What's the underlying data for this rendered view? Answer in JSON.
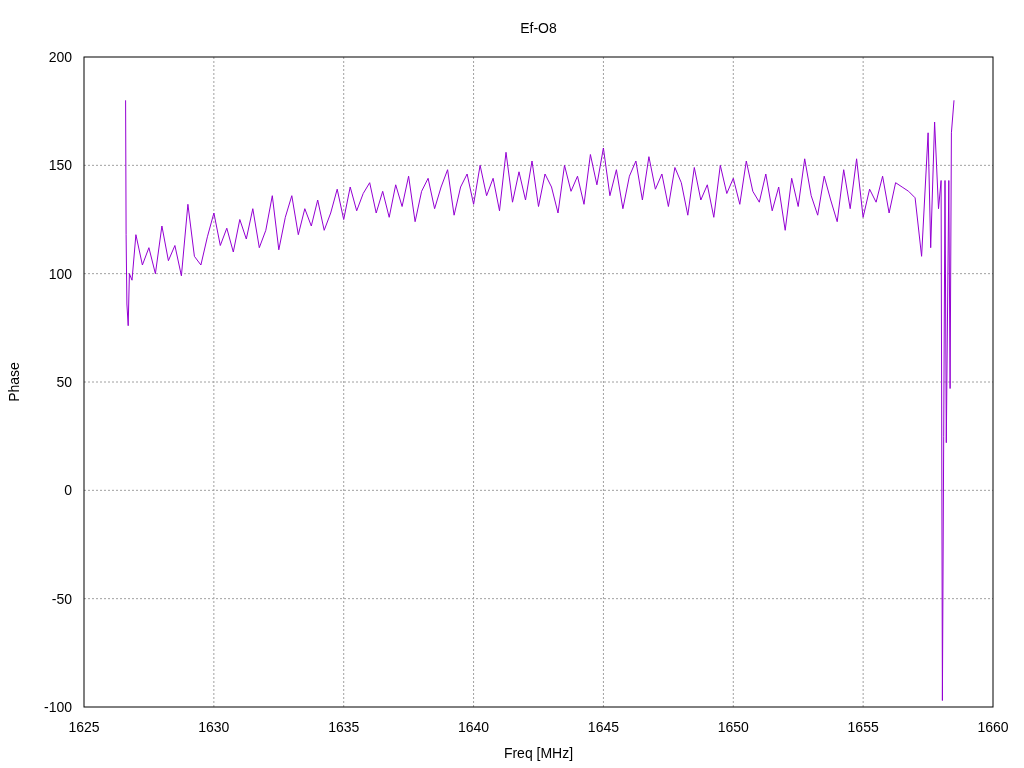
{
  "chart_data": {
    "type": "line",
    "title": "Ef-O8",
    "xlabel": "Freq [MHz]",
    "ylabel": "Phase",
    "x": [
      1626.6,
      1626.62,
      1626.65,
      1626.7,
      1626.75,
      1626.85,
      1627,
      1627.25,
      1627.5,
      1627.75,
      1628,
      1628.25,
      1628.5,
      1628.75,
      1629,
      1629.25,
      1629.5,
      1629.75,
      1630,
      1630.25,
      1630.5,
      1630.75,
      1631,
      1631.25,
      1631.5,
      1631.75,
      1632,
      1632.25,
      1632.5,
      1632.75,
      1633,
      1633.25,
      1633.5,
      1633.75,
      1634,
      1634.25,
      1634.5,
      1634.75,
      1635,
      1635.25,
      1635.5,
      1635.75,
      1636,
      1636.25,
      1636.5,
      1636.75,
      1637,
      1637.25,
      1637.5,
      1637.75,
      1638,
      1638.25,
      1638.5,
      1638.75,
      1639,
      1639.25,
      1639.5,
      1639.75,
      1640,
      1640.25,
      1640.5,
      1640.75,
      1641,
      1641.25,
      1641.5,
      1641.75,
      1642,
      1642.25,
      1642.5,
      1642.75,
      1643,
      1643.25,
      1643.5,
      1643.75,
      1644,
      1644.25,
      1644.5,
      1644.75,
      1645,
      1645.25,
      1645.5,
      1645.75,
      1646,
      1646.25,
      1646.5,
      1646.75,
      1647,
      1647.25,
      1647.5,
      1647.75,
      1648,
      1648.25,
      1648.5,
      1648.75,
      1649,
      1649.25,
      1649.5,
      1649.75,
      1650,
      1650.25,
      1650.5,
      1650.75,
      1651,
      1651.25,
      1651.5,
      1651.75,
      1652,
      1652.25,
      1652.5,
      1652.75,
      1653,
      1653.25,
      1653.5,
      1653.75,
      1654,
      1654.25,
      1654.5,
      1654.75,
      1655,
      1655.25,
      1655.5,
      1655.75,
      1656,
      1656.25,
      1656.5,
      1656.75,
      1657,
      1657.25,
      1657.5,
      1657.6,
      1657.75,
      1657.9,
      1658,
      1658.05,
      1658.1,
      1658.15,
      1658.2,
      1658.3,
      1658.35,
      1658.4,
      1658.5
    ],
    "series": [
      {
        "color": "#9400d3",
        "values": [
          180,
          118,
          86,
          76,
          100,
          97,
          118,
          104,
          112,
          100,
          122,
          106,
          113,
          99,
          132,
          108,
          104,
          117,
          128,
          113,
          121,
          110,
          125,
          116,
          130,
          112,
          120,
          136,
          111,
          126,
          136,
          118,
          130,
          122,
          134,
          120,
          128,
          139,
          125,
          140,
          129,
          137,
          142,
          128,
          138,
          126,
          141,
          131,
          145,
          124,
          138,
          144,
          130,
          140,
          148,
          127,
          140,
          146,
          132,
          150,
          136,
          144,
          129,
          156,
          133,
          147,
          134,
          152,
          131,
          146,
          140,
          128,
          150,
          138,
          145,
          132,
          155,
          141,
          158,
          136,
          148,
          130,
          145,
          152,
          134,
          154,
          139,
          146,
          131,
          149,
          142,
          127,
          149,
          134,
          141,
          126,
          150,
          137,
          144,
          132,
          152,
          138,
          133,
          146,
          129,
          140,
          120,
          144,
          131,
          153,
          136,
          127,
          145,
          134,
          124,
          148,
          130,
          153,
          126,
          139,
          133,
          145,
          128,
          142,
          140,
          138,
          135,
          108,
          165,
          112,
          170,
          130,
          143,
          -97,
          25,
          143,
          22,
          143,
          47,
          165,
          180
        ]
      }
    ],
    "grid": true,
    "xlim": [
      1625,
      1660
    ],
    "ylim": [
      -100,
      200
    ],
    "xticks": [
      1625,
      1630,
      1635,
      1640,
      1645,
      1650,
      1655,
      1660
    ],
    "yticks": [
      -100,
      -50,
      0,
      50,
      100,
      150,
      200
    ]
  }
}
